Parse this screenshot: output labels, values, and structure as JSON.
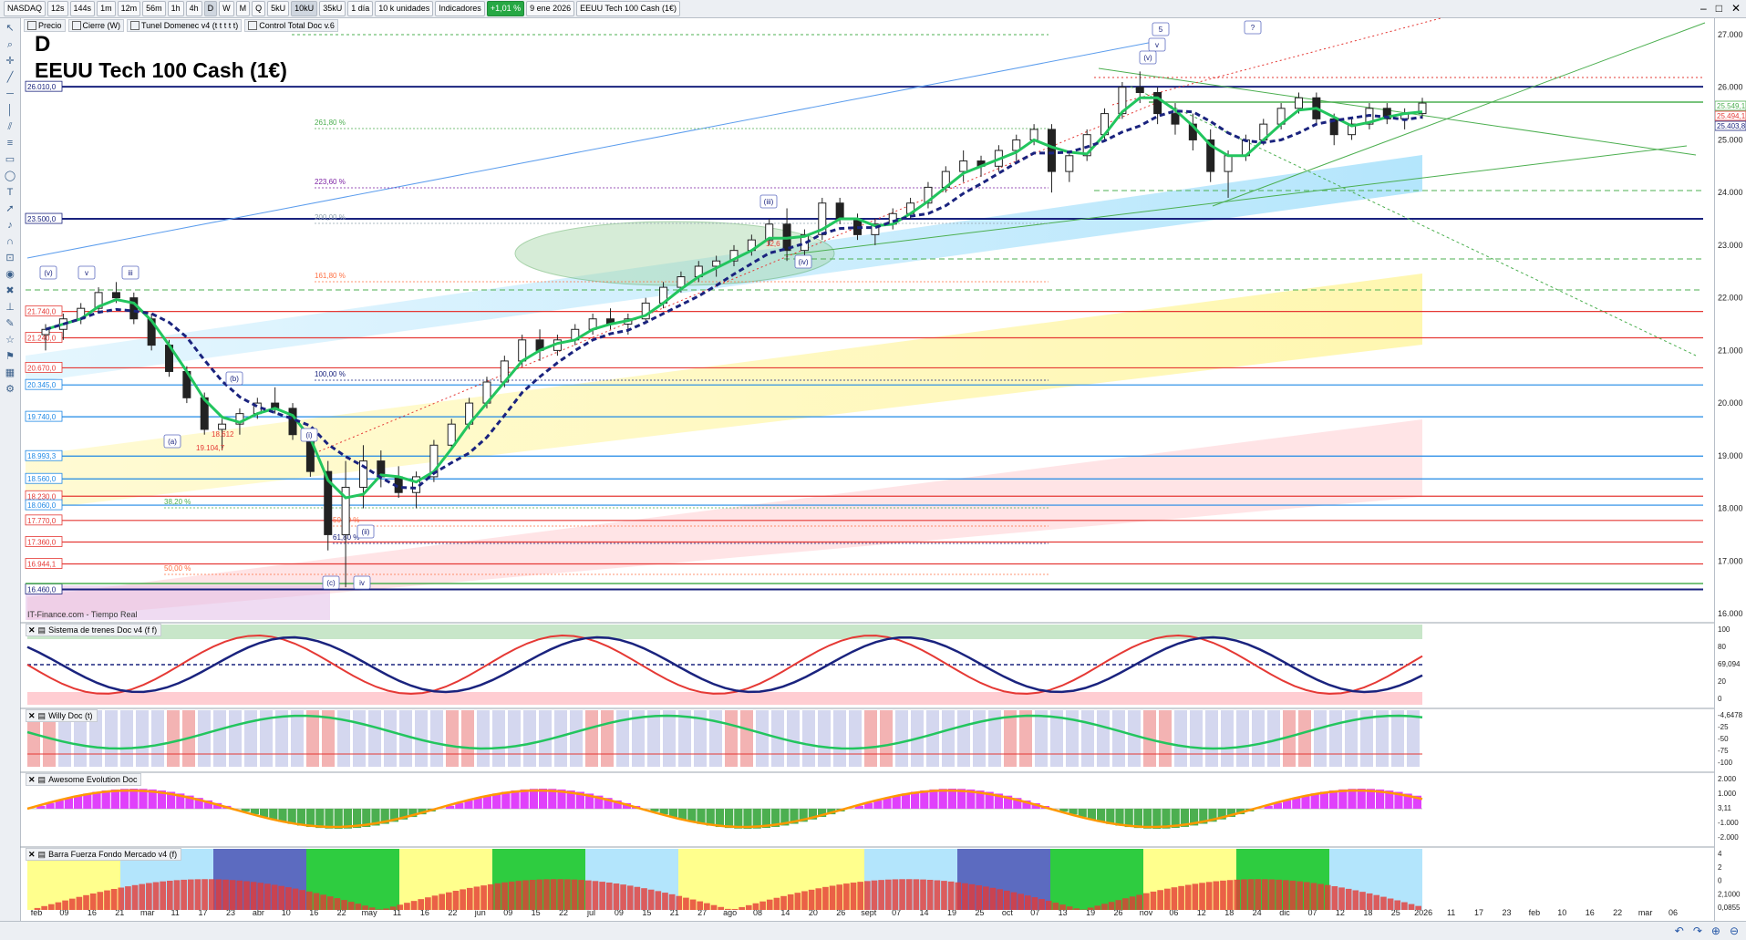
{
  "toolbar": {
    "symbol": "NASDAQ",
    "timeframes": [
      "12s",
      "144s",
      "1m",
      "12m",
      "56m",
      "1h",
      "4h",
      "D",
      "W",
      "M",
      "Q"
    ],
    "active_tf": "D",
    "ticks": [
      "5kU",
      "10kU",
      "35kU"
    ],
    "active_tick": "10kU",
    "period": "1 día",
    "units": "10 k unidades",
    "indicators": "Indicadores",
    "change": "+1,01 %",
    "date": "9 ene 2026",
    "instrument": "EEUU Tech 100 Cash (1€)"
  },
  "indicator_chips": [
    "Precio",
    "Cierre (W)",
    "Tunel Domenec v4 (t t t t t)",
    "Control Total Doc v.6"
  ],
  "chart": {
    "timeframe_letter": "D",
    "title": "EEUU Tech 100 Cash (1€)",
    "source": "IT-Finance.com - Tiempo Real",
    "price_ticks": [
      "27.000",
      "26.000",
      "25.000",
      "24.000",
      "23.000",
      "22.000",
      "21.000",
      "20.000",
      "19.000",
      "18.000",
      "17.000",
      "16.000"
    ],
    "price_values": [
      27000,
      26000,
      25000,
      24000,
      23000,
      22000,
      21000,
      20000,
      19000,
      18000,
      17000,
      16000
    ],
    "right_labels": [
      "25.549,1",
      "25.494,1",
      "25.403,8"
    ],
    "levels": [
      {
        "label": "26.010,0",
        "value": 26010,
        "color": "#1a237e"
      },
      {
        "label": "23.500,0",
        "value": 23500,
        "color": "#1a237e"
      },
      {
        "label": "21.740,0",
        "value": 21740,
        "color": "#e53935"
      },
      {
        "label": "21.240,0",
        "value": 21240,
        "color": "#e53935"
      },
      {
        "label": "20.670,0",
        "value": 20670,
        "color": "#e53935"
      },
      {
        "label": "20.345,0",
        "value": 20345,
        "color": "#1e88e5"
      },
      {
        "label": "19.740,0",
        "value": 19740,
        "color": "#1e88e5"
      },
      {
        "label": "18.993,3",
        "value": 18993,
        "color": "#1e88e5"
      },
      {
        "label": "18.560,0",
        "value": 18560,
        "color": "#1e88e5"
      },
      {
        "label": "18.230,0",
        "value": 18230,
        "color": "#e53935"
      },
      {
        "label": "18.060,0",
        "value": 18060,
        "color": "#1e88e5"
      },
      {
        "label": "17.770,0",
        "value": 17770,
        "color": "#e53935"
      },
      {
        "label": "17.360,0",
        "value": 17360,
        "color": "#e53935"
      },
      {
        "label": "16.944,1",
        "value": 16944,
        "color": "#e53935"
      },
      {
        "label": "16.460,0",
        "value": 16460,
        "color": "#1a237e"
      }
    ],
    "fib_labels": [
      {
        "text": "261,80 %",
        "color": "#4caf50"
      },
      {
        "text": "223,60 %",
        "color": "#7b1fa2"
      },
      {
        "text": "200,00 %",
        "color": "#90a4ae"
      },
      {
        "text": "161,80 %",
        "color": "#ff7043"
      },
      {
        "text": "100,00 %",
        "color": "#1a237e"
      },
      {
        "text": "38,20 %",
        "color": "#4caf50"
      },
      {
        "text": "50,00 %",
        "color": "#ff7043"
      },
      {
        "text": "61,80 %",
        "color": "#1a237e"
      },
      {
        "text": "50,00 %",
        "color": "#ff7043"
      }
    ],
    "wave_labels": [
      "5",
      "v",
      "(v)",
      "?",
      "(iii)",
      "(iv)",
      "(v)",
      "v",
      "iii",
      "(b)",
      "(a)",
      "(i)",
      "(ii)",
      "(c)",
      "iv"
    ],
    "small_labels": [
      "19.104,7",
      "18.612",
      "12,6"
    ],
    "x_labels": [
      "feb",
      "09",
      "16",
      "21",
      "mar",
      "11",
      "17",
      "23",
      "abr",
      "10",
      "16",
      "22",
      "may",
      "11",
      "16",
      "22",
      "jun",
      "09",
      "15",
      "22",
      "jul",
      "09",
      "15",
      "21",
      "27",
      "ago",
      "08",
      "14",
      "20",
      "26",
      "sept",
      "07",
      "14",
      "19",
      "25",
      "oct",
      "07",
      "13",
      "19",
      "26",
      "nov",
      "06",
      "12",
      "18",
      "24",
      "dic",
      "07",
      "12",
      "18",
      "25",
      "2026",
      "11",
      "17",
      "23",
      "feb",
      "10",
      "16",
      "22",
      "mar",
      "06"
    ],
    "ohlc": [
      [
        21300,
        21500,
        21000,
        21400
      ],
      [
        21400,
        21700,
        21200,
        21600
      ],
      [
        21600,
        21900,
        21500,
        21800
      ],
      [
        21800,
        22200,
        21700,
        22100
      ],
      [
        22100,
        22300,
        21900,
        22000
      ],
      [
        22000,
        22100,
        21500,
        21600
      ],
      [
        21600,
        21700,
        21000,
        21100
      ],
      [
        21100,
        21200,
        20500,
        20600
      ],
      [
        20600,
        20700,
        20000,
        20100
      ],
      [
        20100,
        20200,
        19400,
        19500
      ],
      [
        19500,
        19700,
        19100,
        19600
      ],
      [
        19600,
        19900,
        19400,
        19800
      ],
      [
        19800,
        20100,
        19700,
        20000
      ],
      [
        20000,
        20300,
        19800,
        19900
      ],
      [
        19900,
        20000,
        19300,
        19400
      ],
      [
        19400,
        19500,
        18600,
        18700
      ],
      [
        18700,
        18900,
        17200,
        17500
      ],
      [
        17500,
        18900,
        16500,
        18400
      ],
      [
        18400,
        19200,
        18000,
        18900
      ],
      [
        18900,
        19100,
        18400,
        18600
      ],
      [
        18600,
        18800,
        18200,
        18300
      ],
      [
        18300,
        18700,
        18000,
        18600
      ],
      [
        18600,
        19300,
        18500,
        19200
      ],
      [
        19200,
        19700,
        19100,
        19600
      ],
      [
        19600,
        20100,
        19500,
        20000
      ],
      [
        20000,
        20500,
        19900,
        20400
      ],
      [
        20400,
        20900,
        20300,
        20800
      ],
      [
        20800,
        21300,
        20700,
        21200
      ],
      [
        21200,
        21400,
        20800,
        21000
      ],
      [
        21000,
        21300,
        20900,
        21200
      ],
      [
        21200,
        21500,
        21100,
        21400
      ],
      [
        21400,
        21700,
        21300,
        21600
      ],
      [
        21600,
        21800,
        21400,
        21500
      ],
      [
        21500,
        21700,
        21300,
        21600
      ],
      [
        21600,
        22000,
        21500,
        21900
      ],
      [
        21900,
        22300,
        21800,
        22200
      ],
      [
        22200,
        22500,
        22100,
        22400
      ],
      [
        22400,
        22700,
        22300,
        22600
      ],
      [
        22600,
        22800,
        22400,
        22700
      ],
      [
        22700,
        23000,
        22600,
        22900
      ],
      [
        22900,
        23200,
        22800,
        23100
      ],
      [
        23100,
        23500,
        23000,
        23400
      ],
      [
        23400,
        23700,
        22700,
        22900
      ],
      [
        22900,
        23300,
        22800,
        23200
      ],
      [
        23200,
        23900,
        23100,
        23800
      ],
      [
        23800,
        23900,
        23400,
        23500
      ],
      [
        23500,
        23600,
        23100,
        23200
      ],
      [
        23200,
        23500,
        23000,
        23400
      ],
      [
        23400,
        23700,
        23300,
        23600
      ],
      [
        23600,
        23900,
        23500,
        23800
      ],
      [
        23800,
        24200,
        23700,
        24100
      ],
      [
        24100,
        24500,
        24000,
        24400
      ],
      [
        24400,
        24800,
        24200,
        24600
      ],
      [
        24600,
        24700,
        24300,
        24500
      ],
      [
        24500,
        24900,
        24400,
        24800
      ],
      [
        24800,
        25100,
        24600,
        25000
      ],
      [
        25000,
        25300,
        24900,
        25200
      ],
      [
        25200,
        25300,
        24000,
        24400
      ],
      [
        24400,
        24800,
        24200,
        24700
      ],
      [
        24700,
        25200,
        24600,
        25100
      ],
      [
        25100,
        25600,
        25000,
        25500
      ],
      [
        25500,
        26100,
        25400,
        26000
      ],
      [
        26000,
        26300,
        25700,
        25900
      ],
      [
        25900,
        26000,
        25300,
        25500
      ],
      [
        25500,
        25700,
        25100,
        25300
      ],
      [
        25300,
        25500,
        24800,
        25000
      ],
      [
        25000,
        25200,
        24200,
        24400
      ],
      [
        24400,
        24800,
        23900,
        24700
      ],
      [
        24700,
        25100,
        24600,
        25000
      ],
      [
        25000,
        25400,
        24900,
        25300
      ],
      [
        25300,
        25700,
        25200,
        25600
      ],
      [
        25600,
        25900,
        25500,
        25800
      ],
      [
        25800,
        25900,
        25300,
        25400
      ],
      [
        25400,
        25500,
        24900,
        25100
      ],
      [
        25100,
        25400,
        25000,
        25300
      ],
      [
        25300,
        25700,
        25200,
        25600
      ],
      [
        25600,
        25700,
        25300,
        25400
      ],
      [
        25400,
        25600,
        25200,
        25500
      ],
      [
        25500,
        25800,
        25400,
        25700
      ]
    ]
  },
  "panes": [
    {
      "name": "Sistema de trenes Doc v4 (f f)",
      "ticks": [
        "100",
        "80",
        "69,094",
        "20",
        "0"
      ]
    },
    {
      "name": "Willy Doc (t)",
      "ticks": [
        "-4,6478",
        "-25",
        "-50",
        "-75",
        "-100"
      ]
    },
    {
      "name": "Awesome Evolution Doc",
      "ticks": [
        "2.000",
        "1.000",
        "3,11",
        "-1.000",
        "-2.000"
      ]
    },
    {
      "name": "Barra Fuerza Fondo Mercado v4 (f)",
      "ticks": [
        "4",
        "2",
        "0",
        "2,1000",
        "0,0855"
      ]
    }
  ],
  "colors": {
    "up": "#1b1b1b",
    "down": "#1b1b1b",
    "green": "#22c55e",
    "red": "#e53935",
    "navy": "#1a237e"
  }
}
